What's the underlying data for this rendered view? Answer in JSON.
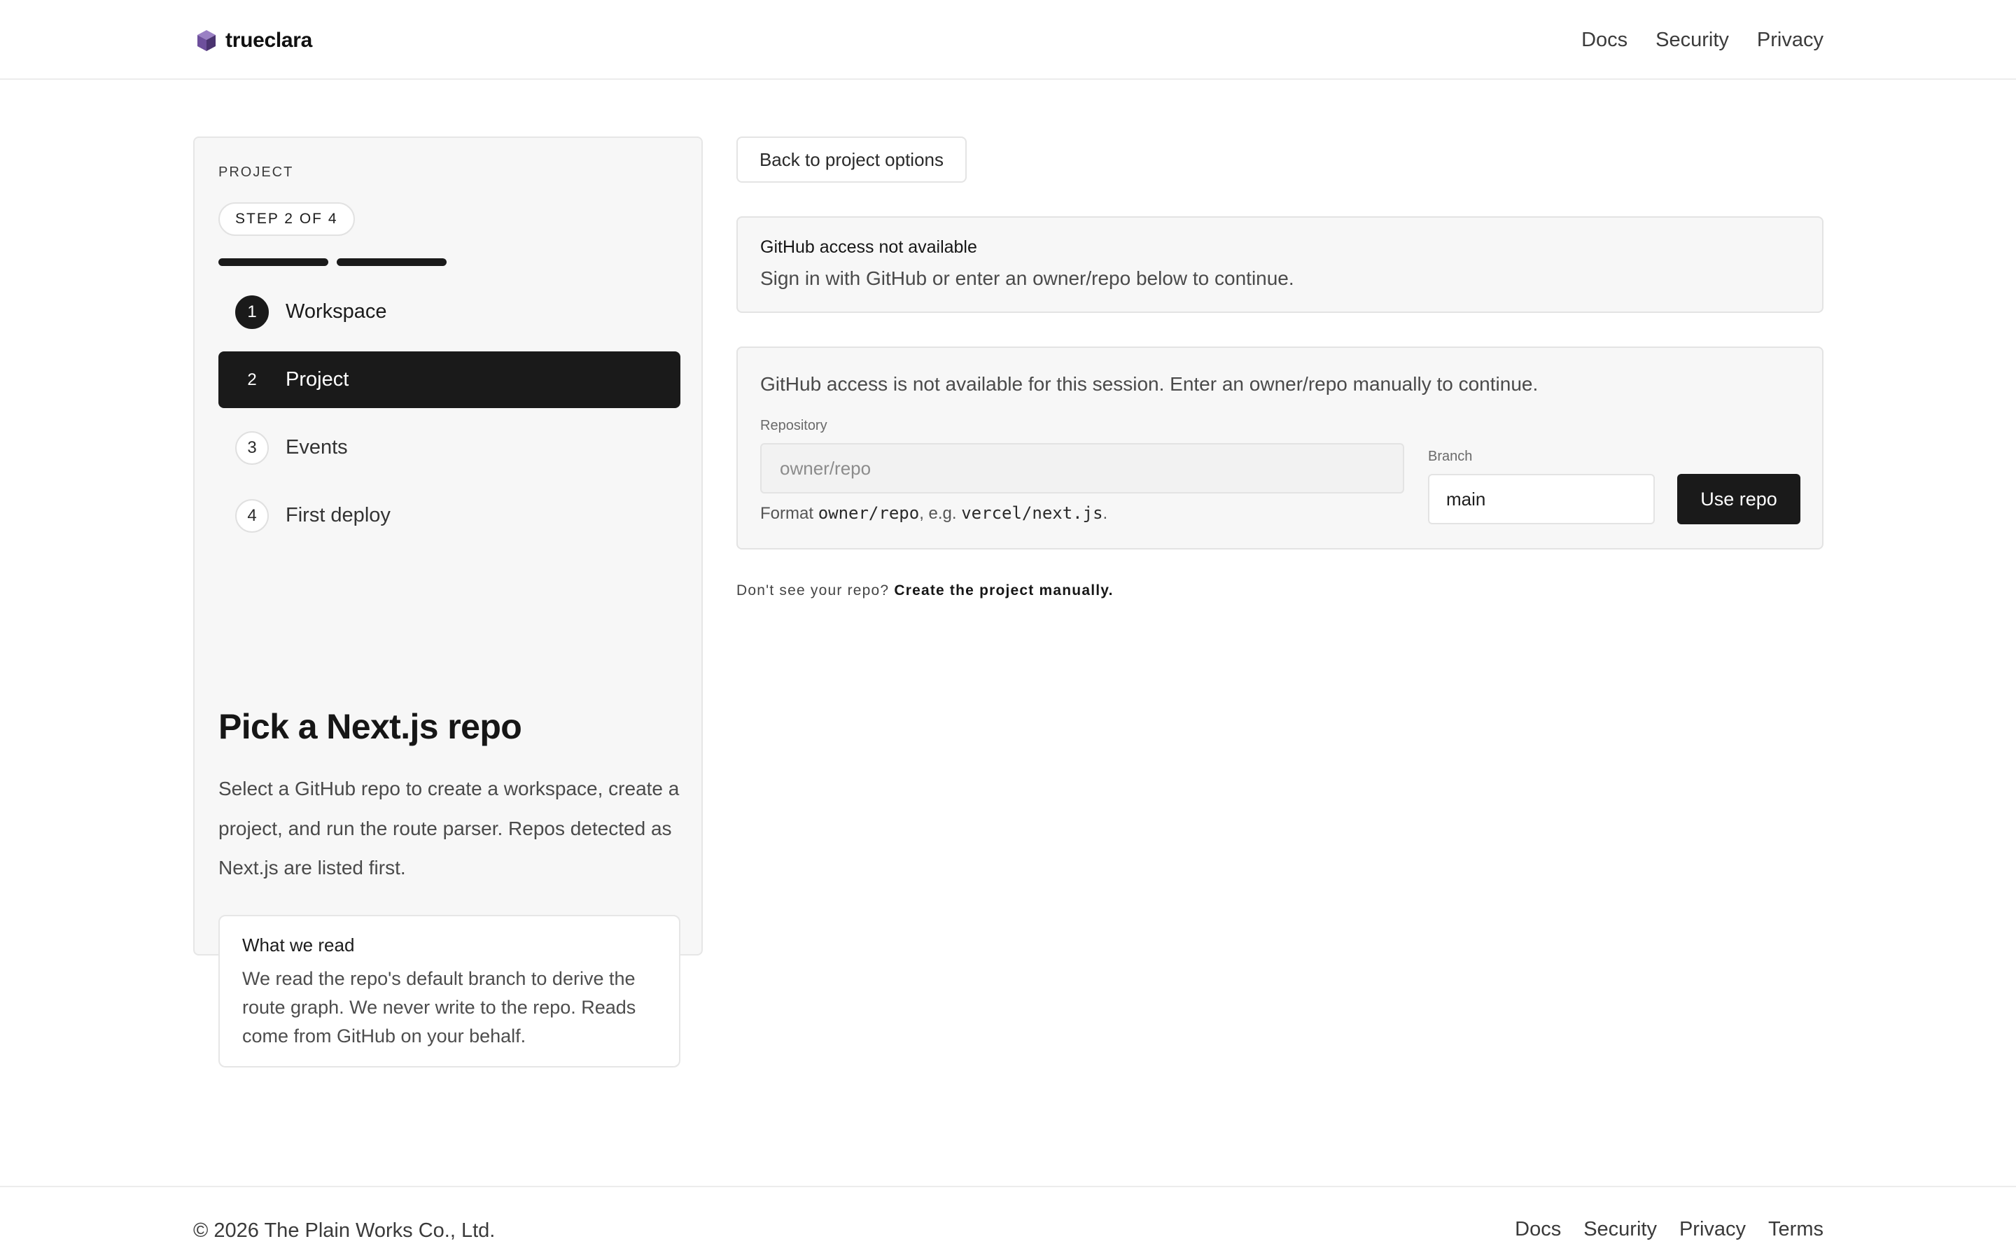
{
  "brand": {
    "name": "trueclara",
    "logo_icon": "cube-icon",
    "accent": "#7b5aa6"
  },
  "header": {
    "nav": [
      "Docs",
      "Security",
      "Privacy"
    ]
  },
  "sidebar": {
    "eyebrow": "PROJECT",
    "step_pill": "STEP 2 OF 4",
    "progress": {
      "completed_segments": 2,
      "total_segments": 4
    },
    "steps": [
      {
        "num": "1",
        "label": "Workspace",
        "state": "done"
      },
      {
        "num": "2",
        "label": "Project",
        "state": "active"
      },
      {
        "num": "3",
        "label": "Events",
        "state": "upcoming"
      },
      {
        "num": "4",
        "label": "First deploy",
        "state": "upcoming"
      }
    ],
    "heading": "Pick a Next.js repo",
    "description": "Select a GitHub repo to create a workspace, create a project, and run the route parser. Repos detected as Next.js are listed first.",
    "note": {
      "title": "What we read",
      "body": "We read the repo's default branch to derive the route graph. We never write to the repo. Reads come from GitHub on your behalf."
    }
  },
  "main": {
    "back_button": "Back to project options",
    "alert": {
      "title": "GitHub access not available",
      "body": "Sign in with GitHub or enter an owner/repo below to continue."
    },
    "manual": {
      "message": "GitHub access is not available for this session. Enter an owner/repo manually to continue.",
      "repo_label": "Repository",
      "repo_placeholder": "owner/repo",
      "repo_value": "",
      "branch_label": "Branch",
      "branch_value": "main",
      "submit_label": "Use repo",
      "hint_prefix": "Format ",
      "hint_code1": "owner/repo",
      "hint_mid": ", e.g. ",
      "hint_code2": "vercel/next.js",
      "hint_suffix": "."
    },
    "manual_line": {
      "prefix": "Don't see your repo? ",
      "link": "Create the project manually."
    }
  },
  "footer": {
    "copyright": "© 2026 The Plain Works Co., Ltd.",
    "nav": [
      "Docs",
      "Security",
      "Privacy",
      "Terms"
    ]
  }
}
